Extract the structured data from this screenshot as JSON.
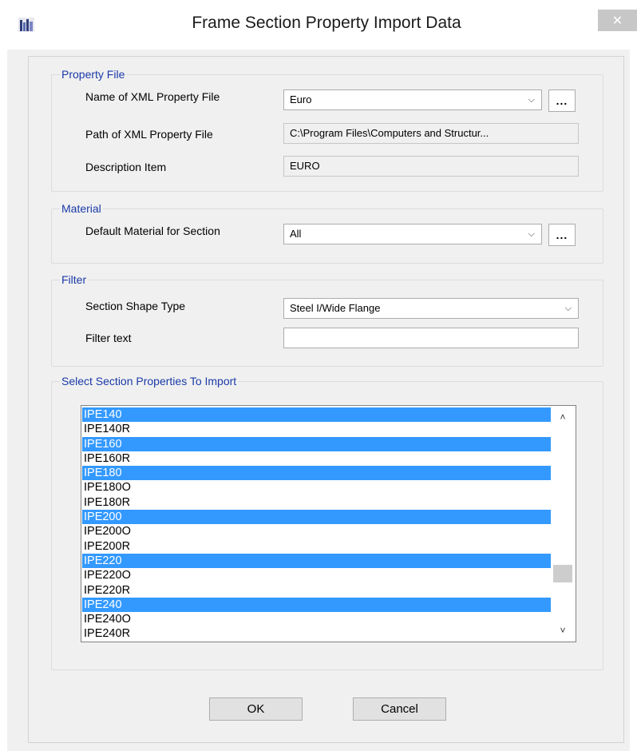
{
  "window": {
    "title": "Frame Section Property Import Data",
    "close_glyph": "✕"
  },
  "property_file": {
    "legend": "Property File",
    "name_label": "Name of XML Property File",
    "name_value": "Euro",
    "path_label": "Path of XML Property File",
    "path_value": "C:\\Program Files\\Computers and Structur...",
    "description_label": "Description Item",
    "description_value": "EURO"
  },
  "material": {
    "legend": "Material",
    "default_label": "Default Material for Section",
    "default_value": "All"
  },
  "filter": {
    "legend": "Filter",
    "shape_label": "Section Shape Type",
    "shape_value": "Steel I/Wide Flange",
    "text_label": "Filter text",
    "text_value": ""
  },
  "sections": {
    "legend": "Select Section Properties To Import",
    "items": [
      {
        "label": "IPE140",
        "selected": true
      },
      {
        "label": "IPE140R",
        "selected": false
      },
      {
        "label": "IPE160",
        "selected": true
      },
      {
        "label": "IPE160R",
        "selected": false
      },
      {
        "label": "IPE180",
        "selected": true
      },
      {
        "label": "IPE180O",
        "selected": false
      },
      {
        "label": "IPE180R",
        "selected": false
      },
      {
        "label": "IPE200",
        "selected": true
      },
      {
        "label": "IPE200O",
        "selected": false
      },
      {
        "label": "IPE200R",
        "selected": false
      },
      {
        "label": "IPE220",
        "selected": true
      },
      {
        "label": "IPE220O",
        "selected": false
      },
      {
        "label": "IPE220R",
        "selected": false
      },
      {
        "label": "IPE240",
        "selected": true
      },
      {
        "label": "IPE240O",
        "selected": false
      },
      {
        "label": "IPE240R",
        "selected": false
      }
    ]
  },
  "buttons": {
    "ok": "OK",
    "cancel": "Cancel",
    "browse": "..."
  },
  "icons": {
    "app": "etabs-app-icon",
    "chevron": "chevron-down-icon",
    "scroll_up": "chevron-up-icon",
    "scroll_down": "chevron-down-icon"
  },
  "colors": {
    "selection": "#3399ff",
    "legend_text": "#1a3aa8",
    "dialog_bg": "#f0f0f0"
  }
}
